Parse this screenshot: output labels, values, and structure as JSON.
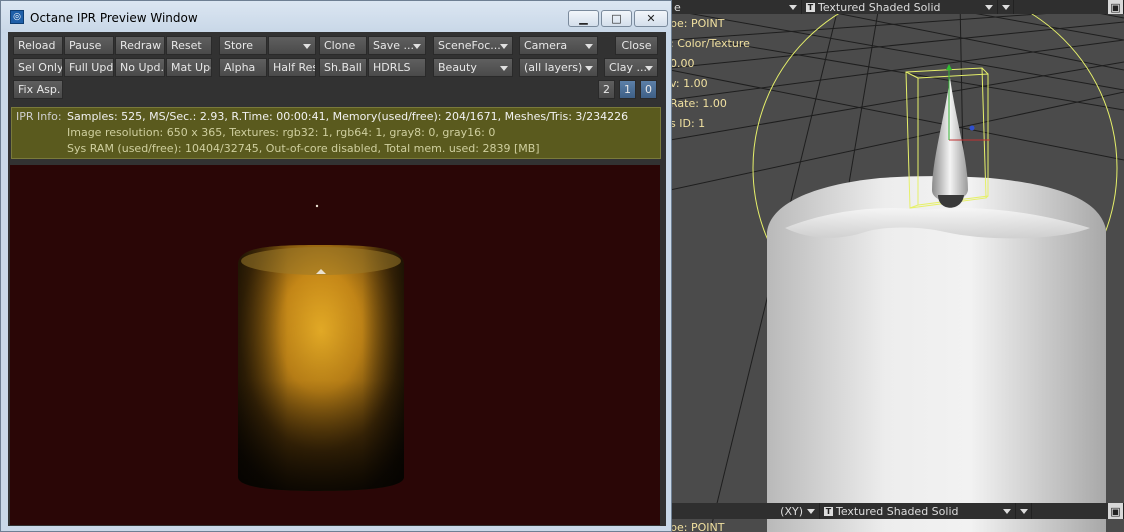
{
  "window": {
    "title": "Octane IPR Preview Window",
    "controls": {
      "minimize": "▁",
      "maximize": "□",
      "close": "✕"
    }
  },
  "toolbar": {
    "row1": {
      "reload": "Reload",
      "pause": "Pause",
      "redraw": "Redraw",
      "reset": "Reset",
      "store": "Store",
      "store_slot": "",
      "clone": "Clone",
      "save": "Save ...",
      "scene_focus": "SceneFoc...",
      "camera": "Camera",
      "close": "Close"
    },
    "row2": {
      "sel_only": "Sel Only",
      "full_upd": "Full Upd.",
      "no_upd": "No Upd.",
      "mat_upd": "Mat Upd",
      "alpha": "Alpha",
      "half_res": "Half Res",
      "sh_ball": "Sh.Ball",
      "hdrls": "HDRLS",
      "beauty": "Beauty",
      "layers": "(all layers)",
      "clay": "Clay ...",
      "num_2": "2",
      "num_1": "1",
      "num_0": "0"
    },
    "row3": {
      "fix_asp": "Fix Asp."
    }
  },
  "ipr_info": {
    "label": "IPR Info:",
    "line1": "Samples: 525, MS/Sec.: 2.93, R.Time: 00:00:41, Memory(used/free): 204/1671, Meshes/Tris: 3/234226",
    "line2": "Image resolution: 650 x 365, Textures:  rgb32: 1, rgb64: 1, gray8: 0, gray16: 0",
    "line3": "Sys RAM (used/free): 10404/32745, Out-of-core disabled, Total mem. used: 2839  [MB]"
  },
  "viewport_top": {
    "view_label": "e",
    "mode": "Textured Shaded Solid",
    "info": [
      "pe: POINT",
      ": Color/Texture",
      "0.00",
      "v: 1.00",
      " Rate: 1.00",
      "s ID: 1"
    ]
  },
  "viewport_bottom": {
    "view_label": "(XY)",
    "mode": "Textured Shaded Solid",
    "info": "pe: POINT"
  },
  "colors": {
    "render_bg": "#2a0606",
    "candle_glow": "#d89a1e",
    "ipr_info_bg": "#5a5a1e",
    "active_num_button": "#4a6d96",
    "selection_yellow": "#e6f06a"
  }
}
